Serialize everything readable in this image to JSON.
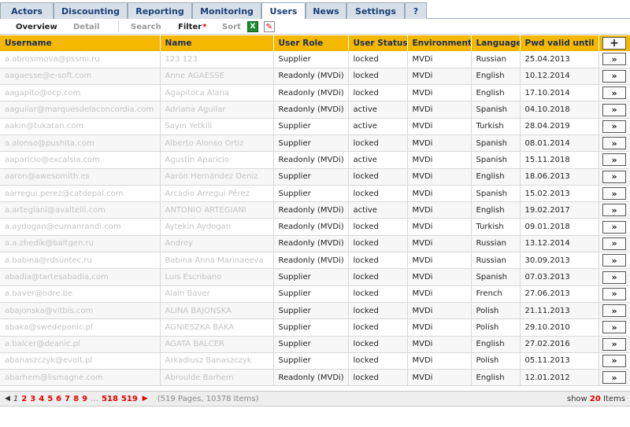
{
  "tabs": [
    "Actors",
    "Discounting",
    "Reporting",
    "Monitoring",
    "Users",
    "News",
    "Settings",
    "?"
  ],
  "active_tab": "Users",
  "toolbar": {
    "overview": "Overview",
    "detail": "Detail",
    "search": "Search",
    "filter": "Filter",
    "filter_marker": "*",
    "sort": "Sort",
    "excel_icon": "excel-export-icon",
    "pin_icon": "pin-icon"
  },
  "columns": [
    "Username",
    "Name",
    "User Role",
    "User Status",
    "Environment",
    "Language",
    "Pwd valid until"
  ],
  "add_button": "+",
  "row_button": "»",
  "rows": [
    {
      "username": "a.abrosimova@pssmi.ru",
      "name": "123 123",
      "role": "Supplier",
      "status": "locked",
      "env": "MVDi",
      "lang": "Russian",
      "pwd": "25.04.2013"
    },
    {
      "username": "aagaesse@e-soft.com",
      "name": "Anne AGAESSE",
      "role": "Readonly (MVDi)",
      "status": "locked",
      "env": "MVDi",
      "lang": "English",
      "pwd": "10.12.2014"
    },
    {
      "username": "aagapito@ocp.com",
      "name": "Agapitoca Alana",
      "role": "Readonly (MVDi)",
      "status": "locked",
      "env": "MVDi",
      "lang": "English",
      "pwd": "17.10.2014"
    },
    {
      "username": "aaguilar@marquesdelaconcordia.com",
      "name": "Adriana Aguilar",
      "role": "Readonly (MVDi)",
      "status": "active",
      "env": "MVDi",
      "lang": "Spanish",
      "pwd": "04.10.2018"
    },
    {
      "username": "aakin@tukatan.com",
      "name": "Sayın Yetkili",
      "role": "Supplier",
      "status": "active",
      "env": "MVDi",
      "lang": "Turkish",
      "pwd": "28.04.2019"
    },
    {
      "username": "a.alonso@pushita.com",
      "name": "Alberto Alonso Ortiz",
      "role": "Supplier",
      "status": "locked",
      "env": "MVDi",
      "lang": "Spanish",
      "pwd": "08.01.2014"
    },
    {
      "username": "aaparicio@excalsia.com",
      "name": "Agustin Aparicio",
      "role": "Readonly (MVDi)",
      "status": "active",
      "env": "MVDi",
      "lang": "Spanish",
      "pwd": "15.11.2018"
    },
    {
      "username": "aaron@awesomith.es",
      "name": "Aarón Hernández Deniz",
      "role": "Supplier",
      "status": "locked",
      "env": "MVDi",
      "lang": "English",
      "pwd": "18.06.2013"
    },
    {
      "username": "aarregui.perez@catdepal.com",
      "name": "Arcadio Arregui Pérez",
      "role": "Supplier",
      "status": "locked",
      "env": "MVDi",
      "lang": "Spanish",
      "pwd": "15.02.2013"
    },
    {
      "username": "a.artegiani@avaltelli.com",
      "name": "ANTONIO ARTEGIANI",
      "role": "Readonly (MVDi)",
      "status": "active",
      "env": "MVDi",
      "lang": "English",
      "pwd": "19.02.2017"
    },
    {
      "username": "a.aydogan@eumanrandi.com",
      "name": "Aytekin Aydogan",
      "role": "Readonly (MVDi)",
      "status": "locked",
      "env": "MVDi",
      "lang": "Turkish",
      "pwd": "09.01.2018"
    },
    {
      "username": "a.a.zhedik@baltgen.ru",
      "name": "Andrey",
      "role": "Readonly (MVDi)",
      "status": "locked",
      "env": "MVDi",
      "lang": "Russian",
      "pwd": "13.12.2014"
    },
    {
      "username": "a.babina@rdsuntec.ru",
      "name": "Babina Anna Marinaeeva",
      "role": "Readonly (MVDi)",
      "status": "locked",
      "env": "MVDi",
      "lang": "Russian",
      "pwd": "30.09.2013"
    },
    {
      "username": "abadia@tartesabadia.com",
      "name": "Luis Escribano",
      "role": "Supplier",
      "status": "locked",
      "env": "MVDi",
      "lang": "Spanish",
      "pwd": "07.03.2013"
    },
    {
      "username": "a.baver@odre.be",
      "name": "Alain Baver",
      "role": "Supplier",
      "status": "locked",
      "env": "MVDi",
      "lang": "French",
      "pwd": "27.06.2013"
    },
    {
      "username": "abajonska@vitbis.com",
      "name": "ALINA BAJONSKA",
      "role": "Supplier",
      "status": "locked",
      "env": "MVDi",
      "lang": "Polish",
      "pwd": "21.11.2013"
    },
    {
      "username": "abaka@swedeponic.pl",
      "name": "AGNIESZKA BAKA",
      "role": "Supplier",
      "status": "locked",
      "env": "MVDi",
      "lang": "Polish",
      "pwd": "29.10.2010"
    },
    {
      "username": "a.balcer@deanic.pl",
      "name": "AGATA BALCER",
      "role": "Supplier",
      "status": "locked",
      "env": "MVDi",
      "lang": "English",
      "pwd": "27.02.2016"
    },
    {
      "username": "abanaszczyk@evoit.pl",
      "name": "Arkadiusz Banaszczyk",
      "role": "Supplier",
      "status": "locked",
      "env": "MVDi",
      "lang": "Polish",
      "pwd": "05.11.2013"
    },
    {
      "username": "abarhem@lismagne.com",
      "name": "Abroulde Barhem",
      "role": "Readonly (MVDi)",
      "status": "locked",
      "env": "MVDi",
      "lang": "English",
      "pwd": "12.01.2012"
    }
  ],
  "pager": {
    "prev_arrow": "◀",
    "current_page": "1",
    "pages": [
      "2",
      "3",
      "4",
      "5",
      "6",
      "7",
      "8",
      "9"
    ],
    "ellipsis": "…",
    "last_pages": [
      "518",
      "519"
    ],
    "next_arrow": "▶",
    "info": "(519 Pages, 10378 Items)",
    "show_prefix": "show",
    "show_count": "20",
    "show_suffix": "Items"
  }
}
